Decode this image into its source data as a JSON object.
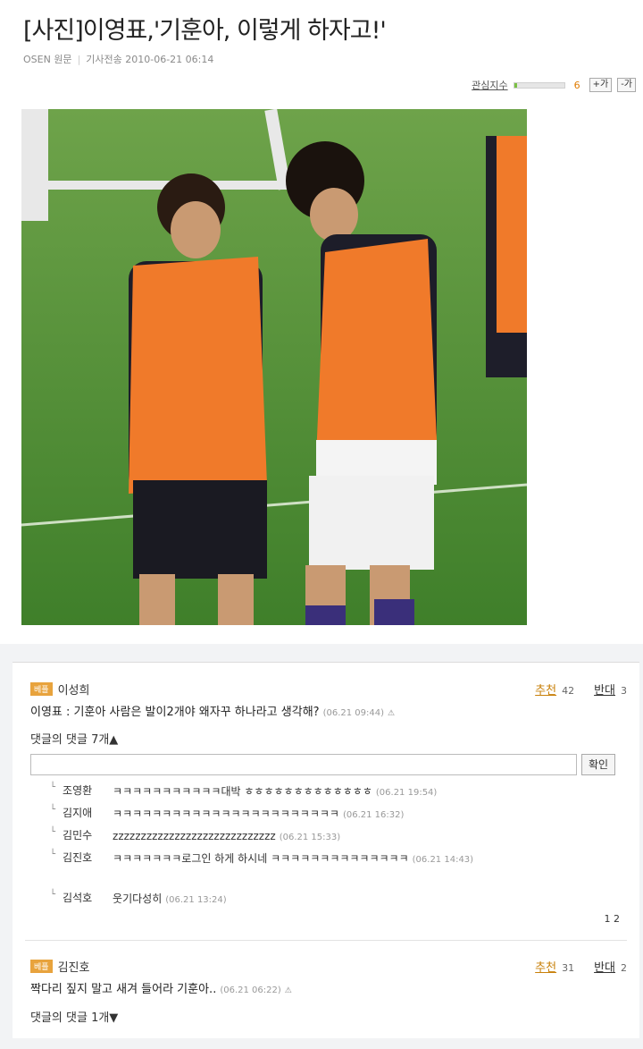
{
  "article": {
    "title": "[사진]이영표,'기훈아, 이렇게 하자고!'",
    "source": "OSEN 원문",
    "date": "기사전송 2010-06-21 06:14",
    "interest_label": "관심지수",
    "interest_value": "6",
    "interest_level": 0.06,
    "plus_label": "+가",
    "minus_label": "-가"
  },
  "comments": [
    {
      "badge": "베플",
      "name": "이성희",
      "up_label": "추천",
      "up_count": "42",
      "down_label": "반대",
      "down_count": "3",
      "text": "이영표 : 기훈아 사람은 발이2개야 왜자꾸 하나라고 생각해?",
      "time": "(06.21 09:44)",
      "replies_toggle": "댓글의 댓글 7개▲",
      "confirm_label": "확인",
      "replies": [
        {
          "name": "조영환",
          "text": "ㅋㅋㅋㅋㅋㅋㅋㅋㅋㅋㅋ대박 ㅎㅎㅎㅎㅎㅎㅎㅎㅎㅎㅎㅎㅎ",
          "time": "(06.21 19:54)"
        },
        {
          "name": "김지애",
          "text": "ㅋㅋㅋㅋㅋㅋㅋㅋㅋㅋㅋㅋㅋㅋㅋㅋㅋㅋㅋㅋㅋㅋㅋ",
          "time": "(06.21 16:32)"
        },
        {
          "name": "김민수",
          "text": "zzzzzzzzzzzzzzzzzzzzzzzzzzzzz",
          "time": "(06.21 15:33)"
        },
        {
          "name": "김진호",
          "text": "ㅋㅋㅋㅋㅋㅋㅋ로그인 하게 하시네 ㅋㅋㅋㅋㅋㅋㅋㅋㅋㅋㅋㅋㅋㅋ",
          "time": "(06.21 14:43)"
        },
        {
          "name": "김석호",
          "text": "웃기다성히",
          "time": "(06.21 13:24)"
        }
      ],
      "pages": "1 2"
    },
    {
      "badge": "베플",
      "name": "김진호",
      "up_label": "추천",
      "up_count": "31",
      "down_label": "반대",
      "down_count": "2",
      "text": "짝다리 짚지 말고 새겨 들어라 기훈아..",
      "time": "(06.21 06:22)",
      "replies_toggle": "댓글의 댓글 1개▼"
    }
  ]
}
